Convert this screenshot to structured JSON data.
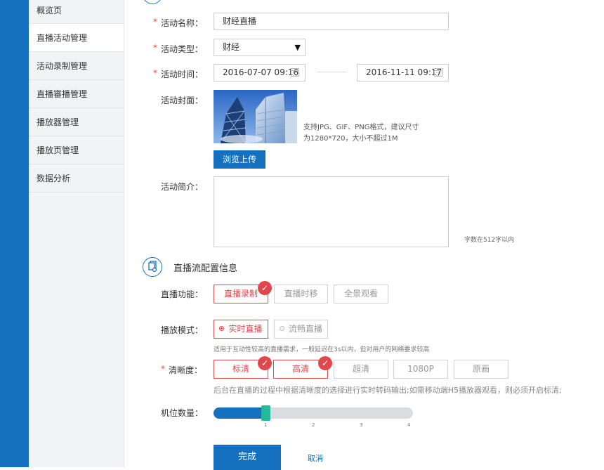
{
  "sidebar": {
    "items": [
      {
        "label": "概览页"
      },
      {
        "label": "直播活动管理"
      },
      {
        "label": "活动录制管理"
      },
      {
        "label": "直播審播管理"
      },
      {
        "label": "播放器管理"
      },
      {
        "label": "播放页管理"
      },
      {
        "label": "数据分析"
      }
    ],
    "active_index": 1
  },
  "form": {
    "required_mark": "*",
    "name": {
      "label": "活动名称：",
      "value": "财经直播"
    },
    "type": {
      "label": "活动类型：",
      "value": "财经",
      "caret": "▼"
    },
    "time": {
      "label": "活动时间：",
      "start": "2016-07-07 09:16",
      "end": "2016-11-11 09:17"
    },
    "cover": {
      "label": "活动封面：",
      "hint_line1": "支持JPG、GIF、PNG格式，建议尺寸",
      "hint_line2": "为1280*720，大小不超过1M",
      "upload_label": "浏览上传"
    },
    "intro": {
      "label": "活动简介：",
      "value": "",
      "limit_hint": "字数在512字以内"
    }
  },
  "stream_section": {
    "title": "直播流配置信息",
    "function": {
      "label": "直播功能：",
      "options": [
        {
          "label": "直播录制",
          "selected": true
        },
        {
          "label": "直播时移",
          "selected": false
        },
        {
          "label": "全景观看",
          "selected": false
        }
      ]
    },
    "mode": {
      "label": "播放模式：",
      "options": [
        {
          "label": "实时直播",
          "selected": true
        },
        {
          "label": "流畅直播",
          "selected": false
        }
      ],
      "hint": "适用于互动性较高的直播需求，一般延迟在3s以内，但对用户的网络要求较高"
    },
    "quality": {
      "label": "清晰度：",
      "options": [
        {
          "label": "标清",
          "selected": true
        },
        {
          "label": "高清",
          "selected": true
        },
        {
          "label": "超清",
          "selected": false
        },
        {
          "label": "1080P",
          "selected": false
        },
        {
          "label": "原画",
          "selected": false
        }
      ],
      "hint": "后台在直播的过程中根据清晰度的选择进行实时转码输出;如需移动端H5播放器观看，则必须开启标清;"
    },
    "slots": {
      "label": "机位数量：",
      "value": 1,
      "ticks": [
        "1",
        "2",
        "3",
        "4"
      ],
      "min": 0,
      "max": 4
    }
  },
  "actions": {
    "submit": "完成",
    "cancel": "取消"
  },
  "check_glyph": "✓",
  "colors": {
    "brand_blue": "#1670c0",
    "accent_red": "#e0474d",
    "slider_thumb": "#25b89a"
  }
}
